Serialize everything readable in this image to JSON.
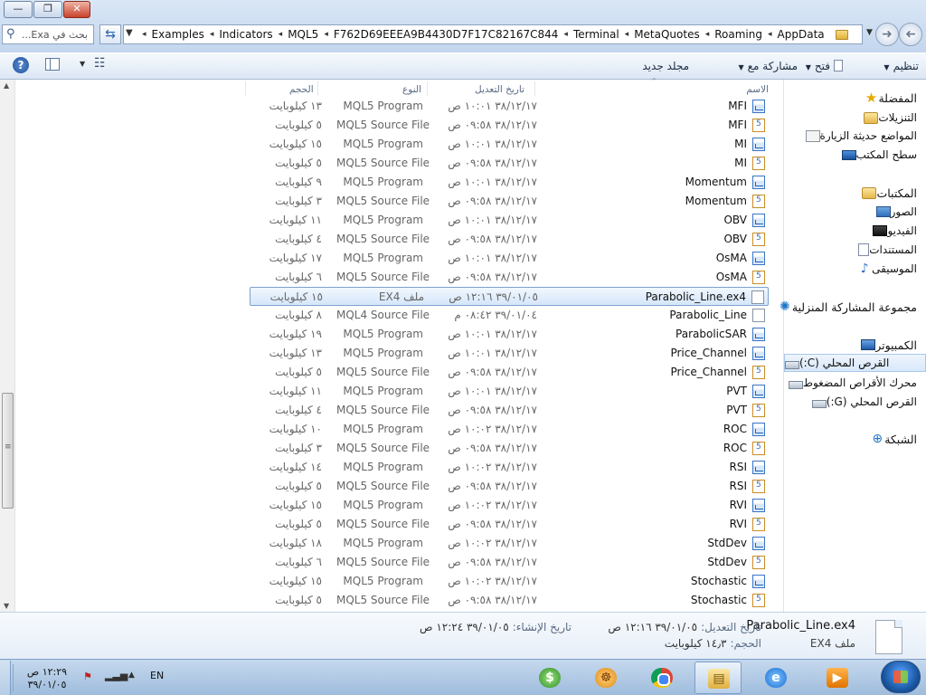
{
  "window": {
    "minimize": "—",
    "restore": "❐",
    "close": "✕"
  },
  "address": {
    "search_placeholder": "بحث في Exa...",
    "crumbs": [
      "AppData",
      "Roaming",
      "MetaQuotes",
      "Terminal",
      "F762D69EEEA9B4430D7F17C82167C844",
      "MQL5",
      "Indicators",
      "Examples"
    ],
    "separator": "◂"
  },
  "toolbar": {
    "organize": "تنظيم",
    "open": "فتح",
    "share": "مشاركة مع",
    "new_folder": "مجلد جديد",
    "dropdown": "▼"
  },
  "columns": {
    "name": "الاسم",
    "date": "تاريخ التعديل",
    "type": "النوع",
    "size": "الحجم"
  },
  "nav": {
    "favorites": "المفضلة",
    "downloads": "التنزيلات",
    "recent": "المواضع حديثة الزيارة",
    "desktop": "سطح المكتب",
    "libraries": "المكتبات",
    "pictures": "الصور",
    "videos": "الفيديو",
    "documents": "المستندات",
    "music": "الموسيقى",
    "homegroup": "مجموعة المشاركة المنزلية",
    "computer": "الكمبيوتر",
    "drive_c": "القرص المحلي (C:)",
    "compressed": "محرك الأقراص المضغوط",
    "drive_g": "القرص المحلي (G:)",
    "network": "الشبكة"
  },
  "files": [
    {
      "name": "MFI",
      "date": "٣٨/١٢/١٧ ١٠:٠١ ص",
      "type": "MQL5 Program",
      "size": "١٣ كيلوبايت",
      "icon": "program"
    },
    {
      "name": "MFI",
      "date": "٣٨/١٢/١٧ ٠٩:٥٨ ص",
      "type": "MQL5 Source File",
      "size": "٥ كيلوبايت",
      "icon": "source"
    },
    {
      "name": "MI",
      "date": "٣٨/١٢/١٧ ١٠:٠١ ص",
      "type": "MQL5 Program",
      "size": "١٥ كيلوبايت",
      "icon": "program"
    },
    {
      "name": "MI",
      "date": "٣٨/١٢/١٧ ٠٩:٥٨ ص",
      "type": "MQL5 Source File",
      "size": "٥ كيلوبايت",
      "icon": "source"
    },
    {
      "name": "Momentum",
      "date": "٣٨/١٢/١٧ ١٠:٠١ ص",
      "type": "MQL5 Program",
      "size": "٩ كيلوبايت",
      "icon": "program"
    },
    {
      "name": "Momentum",
      "date": "٣٨/١٢/١٧ ٠٩:٥٨ ص",
      "type": "MQL5 Source File",
      "size": "٣ كيلوبايت",
      "icon": "source"
    },
    {
      "name": "OBV",
      "date": "٣٨/١٢/١٧ ١٠:٠١ ص",
      "type": "MQL5 Program",
      "size": "١١ كيلوبايت",
      "icon": "program"
    },
    {
      "name": "OBV",
      "date": "٣٨/١٢/١٧ ٠٩:٥٨ ص",
      "type": "MQL5 Source File",
      "size": "٤ كيلوبايت",
      "icon": "source"
    },
    {
      "name": "OsMA",
      "date": "٣٨/١٢/١٧ ١٠:٠١ ص",
      "type": "MQL5 Program",
      "size": "١٧ كيلوبايت",
      "icon": "program"
    },
    {
      "name": "OsMA",
      "date": "٣٨/١٢/١٧ ٠٩:٥٨ ص",
      "type": "MQL5 Source File",
      "size": "٦ كيلوبايت",
      "icon": "source"
    },
    {
      "name": "Parabolic_Line.ex4",
      "date": "٣٩/٠١/٠٥ ١٢:١٦ ص",
      "type": "ملف EX4",
      "size": "١٥ كيلوبايت",
      "icon": "blank",
      "selected": true
    },
    {
      "name": "Parabolic_Line",
      "date": "٣٩/٠١/٠٤ ٠٨:٤٢ م",
      "type": "MQL4 Source File",
      "size": "٨ كيلوبايت",
      "icon": "blank"
    },
    {
      "name": "ParabolicSAR",
      "date": "٣٨/١٢/١٧ ١٠:٠١ ص",
      "type": "MQL5 Program",
      "size": "١٩ كيلوبايت",
      "icon": "program"
    },
    {
      "name": "Price_Channel",
      "date": "٣٨/١٢/١٧ ١٠:٠١ ص",
      "type": "MQL5 Program",
      "size": "١٣ كيلوبايت",
      "icon": "program"
    },
    {
      "name": "Price_Channel",
      "date": "٣٨/١٢/١٧ ٠٩:٥٨ ص",
      "type": "MQL5 Source File",
      "size": "٥ كيلوبايت",
      "icon": "source"
    },
    {
      "name": "PVT",
      "date": "٣٨/١٢/١٧ ١٠:٠١ ص",
      "type": "MQL5 Program",
      "size": "١١ كيلوبايت",
      "icon": "program"
    },
    {
      "name": "PVT",
      "date": "٣٨/١٢/١٧ ٠٩:٥٨ ص",
      "type": "MQL5 Source File",
      "size": "٤ كيلوبايت",
      "icon": "source"
    },
    {
      "name": "ROC",
      "date": "٣٨/١٢/١٧ ١٠:٠٢ ص",
      "type": "MQL5 Program",
      "size": "١٠ كيلوبايت",
      "icon": "program"
    },
    {
      "name": "ROC",
      "date": "٣٨/١٢/١٧ ٠٩:٥٨ ص",
      "type": "MQL5 Source File",
      "size": "٣ كيلوبايت",
      "icon": "source"
    },
    {
      "name": "RSI",
      "date": "٣٨/١٢/١٧ ١٠:٠٢ ص",
      "type": "MQL5 Program",
      "size": "١٤ كيلوبايت",
      "icon": "program"
    },
    {
      "name": "RSI",
      "date": "٣٨/١٢/١٧ ٠٩:٥٨ ص",
      "type": "MQL5 Source File",
      "size": "٥ كيلوبايت",
      "icon": "source"
    },
    {
      "name": "RVI",
      "date": "٣٨/١٢/١٧ ١٠:٠٢ ص",
      "type": "MQL5 Program",
      "size": "١٥ كيلوبايت",
      "icon": "program"
    },
    {
      "name": "RVI",
      "date": "٣٨/١٢/١٧ ٠٩:٥٨ ص",
      "type": "MQL5 Source File",
      "size": "٥ كيلوبايت",
      "icon": "source"
    },
    {
      "name": "StdDev",
      "date": "٣٨/١٢/١٧ ١٠:٠٢ ص",
      "type": "MQL5 Program",
      "size": "١٨ كيلوبايت",
      "icon": "program"
    },
    {
      "name": "StdDev",
      "date": "٣٨/١٢/١٧ ٠٩:٥٨ ص",
      "type": "MQL5 Source File",
      "size": "٦ كيلوبايت",
      "icon": "source"
    },
    {
      "name": "Stochastic",
      "date": "٣٨/١٢/١٧ ١٠:٠٢ ص",
      "type": "MQL5 Program",
      "size": "١٥ كيلوبايت",
      "icon": "program"
    },
    {
      "name": "Stochastic",
      "date": "٣٨/١٢/١٧ ٠٩:٥٨ ص",
      "type": "MQL5 Source File",
      "size": "٥ كيلوبايت",
      "icon": "source"
    }
  ],
  "details": {
    "name": "Parabolic_Line.ex4",
    "type": "ملف EX4",
    "modified_key": "تاريخ التعديل:",
    "modified_val": "٣٩/٠١/٠٥ ١٢:١٦ ص",
    "size_key": "الحجم:",
    "size_val": "١٤٫٣ كيلوبايت",
    "created_key": "تاريخ الإنشاء:",
    "created_val": "٣٩/٠١/٠٥ ١٢:٢٤ ص"
  },
  "taskbar": {
    "time": "١٢:٢٩ ص",
    "date": "٣٩/٠١/٠٥",
    "lang": "EN"
  }
}
